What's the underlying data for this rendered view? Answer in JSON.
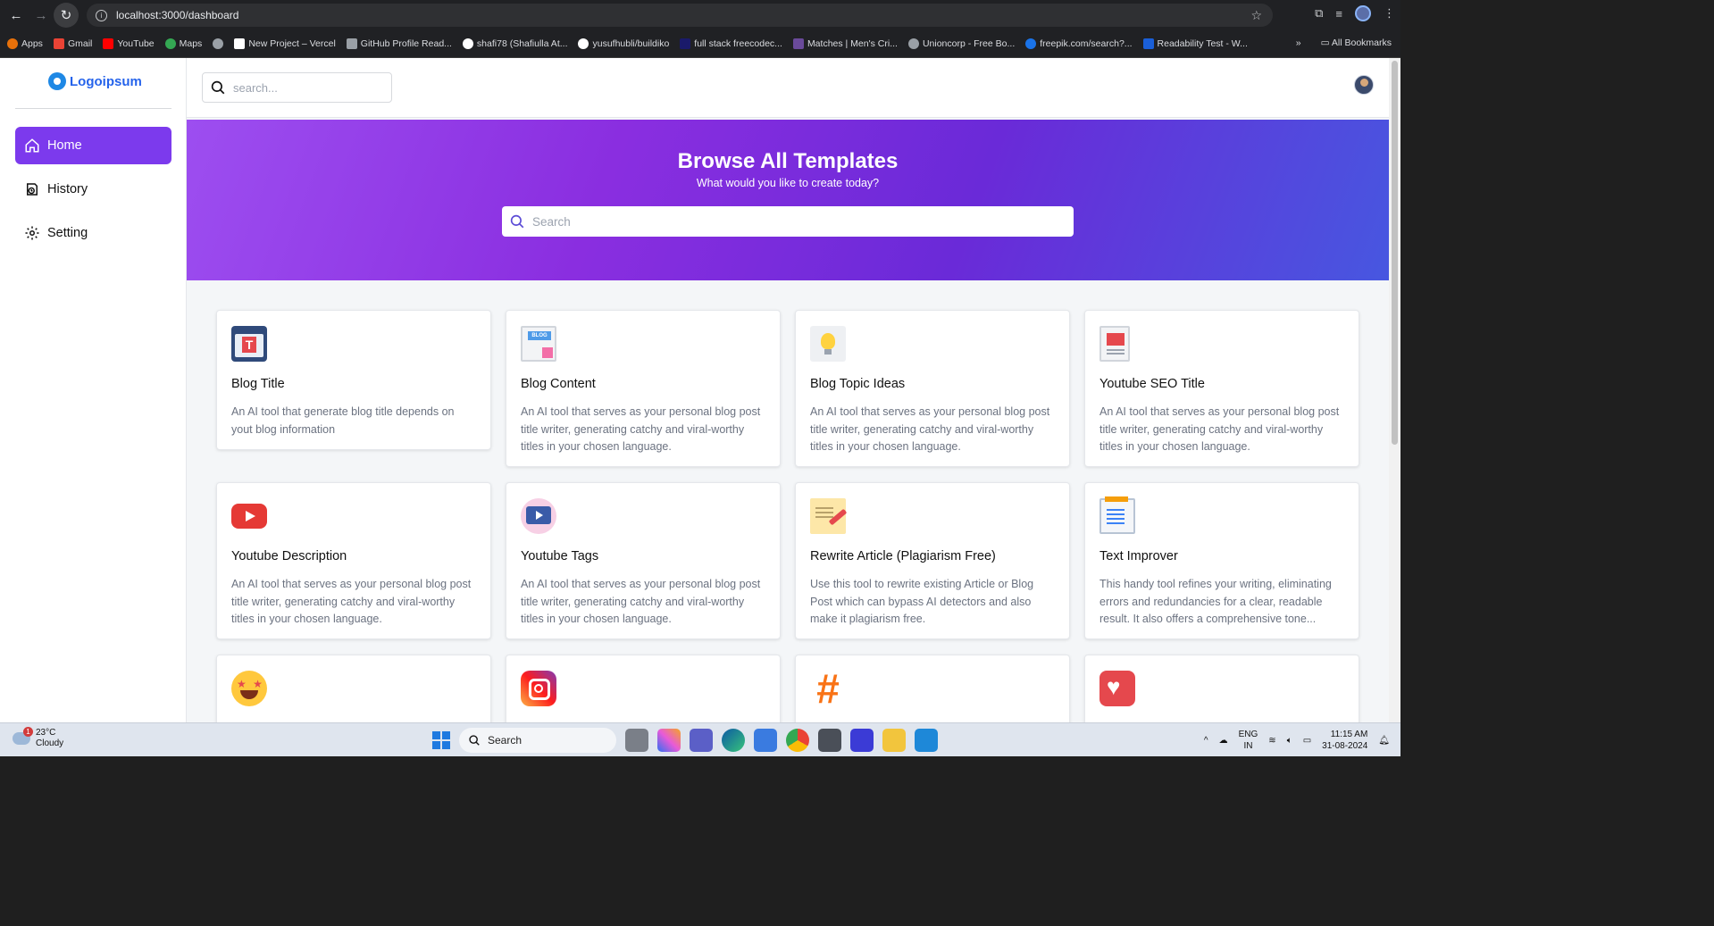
{
  "browser": {
    "url": "localhost:3000/dashboard",
    "bookmarks": [
      "Apps",
      "Gmail",
      "YouTube",
      "Maps",
      "",
      "New Project – Vercel",
      "GitHub Profile Read...",
      "shafi78 (Shafiulla At...",
      "yusufhubli/buildiko",
      "full stack freecodec...",
      "Matches | Men's Cri...",
      "Unioncorp - Free Bo...",
      "freepik.com/search?...",
      "Readability Test - W..."
    ],
    "bookmarks_overflow": "»",
    "all_bookmarks": "All Bookmarks",
    "bookmark_colors": [
      "#e8710a",
      "#ea4335",
      "#ff0000",
      "#34a853",
      "#9aa0a6",
      "#ffffff",
      "#9aa0a6",
      "#ffffff",
      "#ffffff",
      "#1a1a6a",
      "#6a4a9a",
      "#9aa0a6",
      "#1a73e8",
      "#1a5fd8"
    ]
  },
  "sidebar": {
    "logo_text": "Logoipsum",
    "items": [
      {
        "label": "Home",
        "icon": "home-icon",
        "active": true
      },
      {
        "label": "History",
        "icon": "history-icon",
        "active": false
      },
      {
        "label": "Setting",
        "icon": "gear-icon",
        "active": false
      }
    ]
  },
  "topbar": {
    "search_placeholder": "search..."
  },
  "hero": {
    "title": "Browse All Templates",
    "subtitle": "What would you like to create today?",
    "search_placeholder": "Search"
  },
  "cards": [
    {
      "title": "Blog Title",
      "desc": "An AI tool that generate blog title depends on yout blog information",
      "icon": "blog-title-icon"
    },
    {
      "title": "Blog Content",
      "desc": "An AI tool that serves as your personal blog post title writer, generating catchy and viral-worthy titles in your chosen language.",
      "icon": "blog-content-icon"
    },
    {
      "title": "Blog Topic Ideas",
      "desc": "An AI tool that serves as your personal blog post title writer, generating catchy and viral-worthy titles in your chosen language.",
      "icon": "lightbulb-icon"
    },
    {
      "title": "Youtube SEO Title",
      "desc": "An AI tool that serves as your personal blog post title writer, generating catchy and viral-worthy titles in your chosen language.",
      "icon": "seo-doc-icon"
    },
    {
      "title": "Youtube Description",
      "desc": "An AI tool that serves as your personal blog post title writer, generating catchy and viral-worthy titles in your chosen language.",
      "icon": "youtube-icon"
    },
    {
      "title": "Youtube Tags",
      "desc": "An AI tool that serves as your personal blog post title writer, generating catchy and viral-worthy titles in your chosen language.",
      "icon": "youtube-tags-icon"
    },
    {
      "title": "Rewrite Article (Plagiarism Free)",
      "desc": "Use this tool to rewrite existing Article or Blog Post which can bypass AI detectors and also make it plagiarism free.",
      "icon": "rewrite-icon"
    },
    {
      "title": "Text Improver",
      "desc": "This handy tool refines your writing, eliminating errors and redundancies for a clear, readable result. It also offers a comprehensive tone...",
      "icon": "notepad-icon"
    },
    {
      "title": "",
      "desc": "",
      "icon": "star-struck-emoji-icon"
    },
    {
      "title": "",
      "desc": "",
      "icon": "instagram-icon"
    },
    {
      "title": "",
      "desc": "",
      "icon": "hashtag-icon"
    },
    {
      "title": "",
      "desc": "",
      "icon": "heart-message-icon"
    }
  ],
  "taskbar": {
    "temperature": "23°C",
    "condition": "Cloudy",
    "weather_badge": "1",
    "search_label": "Search",
    "lang_top": "ENG",
    "lang_bottom": "IN",
    "time": "11:15 AM",
    "date": "31-08-2024"
  },
  "colors": {
    "accent": "#7c3aed",
    "hero_gradient_start": "#9d4ef0",
    "hero_gradient_end": "#4757e0",
    "logo": "#2563eb"
  }
}
